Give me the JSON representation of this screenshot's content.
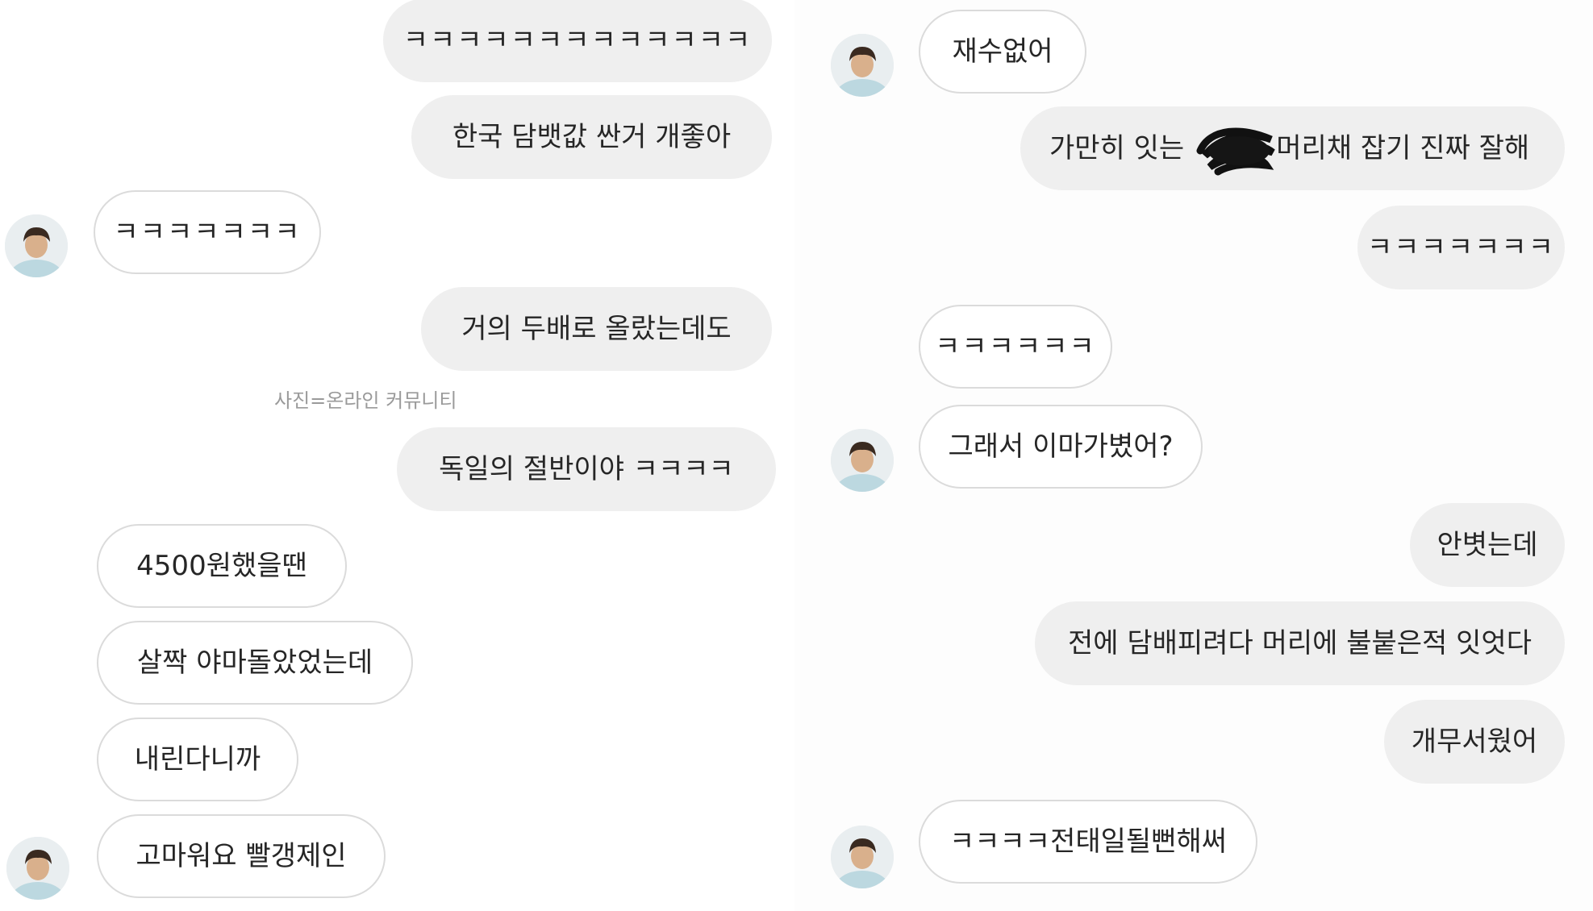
{
  "caption": "사진=온라인 커뮤니티",
  "left_messages": [
    {
      "sender": "me",
      "text": "ㅋㅋㅋㅋㅋㅋㅋㅋㅋㅋㅋㅋㅋ"
    },
    {
      "sender": "me",
      "text": "한국 담뱃값 싼거 개좋아"
    },
    {
      "sender": "them",
      "text": "ㅋㅋㅋㅋㅋㅋㅋ"
    },
    {
      "sender": "me",
      "text": "거의 두배로 올랐는데도"
    },
    {
      "sender": "me",
      "text": "독일의 절반이야 ㅋㅋㅋㅋ"
    },
    {
      "sender": "them",
      "text": "4500원했을땐"
    },
    {
      "sender": "them",
      "text": "살짝 야마돌았었는데"
    },
    {
      "sender": "them",
      "text": "내린다니까"
    },
    {
      "sender": "them",
      "text": "고마워요 빨갱제인"
    }
  ],
  "right_messages": [
    {
      "sender": "them",
      "text": "재수없어"
    },
    {
      "sender": "me",
      "text_before": "가만히 잇는",
      "text_after": "머리채 잡기 진짜 잘해"
    },
    {
      "sender": "me",
      "text": "ㅋㅋㅋㅋㅋㅋㅋ"
    },
    {
      "sender": "them",
      "text": "ㅋㅋㅋㅋㅋㅋ"
    },
    {
      "sender": "them",
      "text": "그래서 이마가볐어?"
    },
    {
      "sender": "me",
      "text": "안볏는데"
    },
    {
      "sender": "me",
      "text": "전에 담배피려다 머리에 불붙은적 잇엇다"
    },
    {
      "sender": "me",
      "text": "개무서웠어"
    },
    {
      "sender": "them",
      "text": "ㅋㅋㅋㅋ전태일될뻔해써"
    }
  ],
  "colors": {
    "my_bubble": "#efefef",
    "their_bubble_border": "#dbdbdb",
    "text": "#262626",
    "caption": "#9a9a9a"
  },
  "icons": {
    "avatar": "profile-photo",
    "redaction": "black-scribble"
  }
}
